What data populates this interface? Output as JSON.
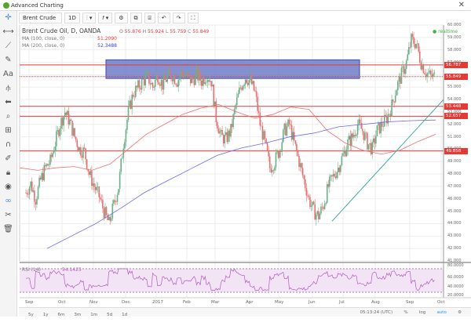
{
  "window": {
    "title": "Advanced Charting"
  },
  "toolbar": {
    "symbol": "Brent Crude Oil",
    "interval": "1D",
    "undo": "↶",
    "redo": "↷"
  },
  "legend": {
    "title": "Brent Crude Oil, D, OANDA",
    "o_label": "O",
    "o": "55.876",
    "h_label": "H",
    "h": "55.924",
    "l_label": "L",
    "l": "55.759",
    "c_label": "C",
    "c": "55.849",
    "ma100": "MA (100, close, 0)",
    "ma100_val": "51.2090",
    "ma200": "MA (200, close, 0)",
    "ma200_val": "52.3488",
    "realtime": "realtime",
    "rsi": "RSI (14)",
    "rsi_val": "54.1425"
  },
  "price_tags": [
    "56.787",
    "55.849",
    "53.448",
    "52.657",
    "49.858"
  ],
  "price_axis": [
    "60.000",
    "59.000",
    "58.000",
    "57.000",
    "55.000",
    "54.000",
    "53.000",
    "52.000",
    "51.000",
    "50.000",
    "49.000",
    "48.000",
    "47.000",
    "46.000",
    "45.000",
    "44.000",
    "43.000",
    "42.000",
    "41.000"
  ],
  "rsi_axis": [
    "80.0000",
    "60.0000",
    "40.0000",
    "20.0000"
  ],
  "date_axis": [
    "Sep",
    "Oct",
    "Nov",
    "Dec",
    "2017",
    "Feb",
    "Mar",
    "Apr",
    "May",
    "Jun",
    "Jul",
    "Aug",
    "Sep",
    "Oct"
  ],
  "periods": [
    "5y",
    "1y",
    "6m",
    "3m",
    "1m",
    "5d",
    "1d"
  ],
  "status": {
    "time": "05:13:24 (UTC)",
    "percent": "%",
    "log": "log",
    "auto": "auto"
  },
  "colors": {
    "up": "#6ab187",
    "down": "#e57373",
    "ma100": "#ef6f6f",
    "ma200": "#6a6af0",
    "zone": "#5c6bc0",
    "trend": "#26a69a",
    "rsi": "#b05bc0"
  },
  "chart_data": {
    "type": "candlestick",
    "closes": [
      46.5,
      47.2,
      46,
      47.5,
      48.5,
      49,
      50.5,
      52,
      53,
      52.2,
      51,
      50,
      49.8,
      48,
      47,
      46.2,
      45,
      44,
      45.5,
      47,
      50.5,
      53,
      54.5,
      55,
      55.5,
      55.8,
      55,
      56,
      55.2,
      55.8,
      56,
      55.5,
      56.2,
      55.8,
      55.5,
      56,
      55.5,
      56,
      55.5,
      52.5,
      51,
      50.8,
      51.5,
      53.5,
      55,
      55.8,
      55.5,
      54.5,
      52,
      50.5,
      48.5,
      49,
      50,
      51.5,
      52,
      50.5,
      49,
      47.5,
      46,
      45,
      44.6,
      45.5,
      47,
      47.8,
      48.5,
      49.5,
      50.5,
      51,
      52,
      51.5,
      50.5,
      50,
      51.5,
      52,
      52.5,
      53.5,
      55,
      56,
      57,
      58.8,
      58.5,
      57,
      56.2,
      55.85
    ],
    "ma100": [
      48.5,
      48.3,
      48.5,
      48.6,
      48.3,
      48.8,
      50,
      51.2,
      52,
      52.8,
      53.3,
      53.6,
      53,
      52.5,
      52.8,
      53.4,
      53.2,
      51.5,
      50.5,
      49.9,
      49.6,
      49.9,
      50.6,
      51.2
    ],
    "ma200": [
      42,
      43,
      44,
      45.2,
      46.5,
      47.5,
      48.5,
      49.5,
      50.1,
      50.5,
      51,
      51.3,
      51.8,
      52,
      52.2,
      52.3,
      52.35
    ],
    "hlines": [
      56.787,
      55.849,
      53.448,
      52.657,
      49.858
    ],
    "zone": {
      "high": 57.2,
      "low": 55.7
    },
    "ylim": [
      41,
      60
    ],
    "rsi_levels": [
      70,
      30
    ]
  }
}
